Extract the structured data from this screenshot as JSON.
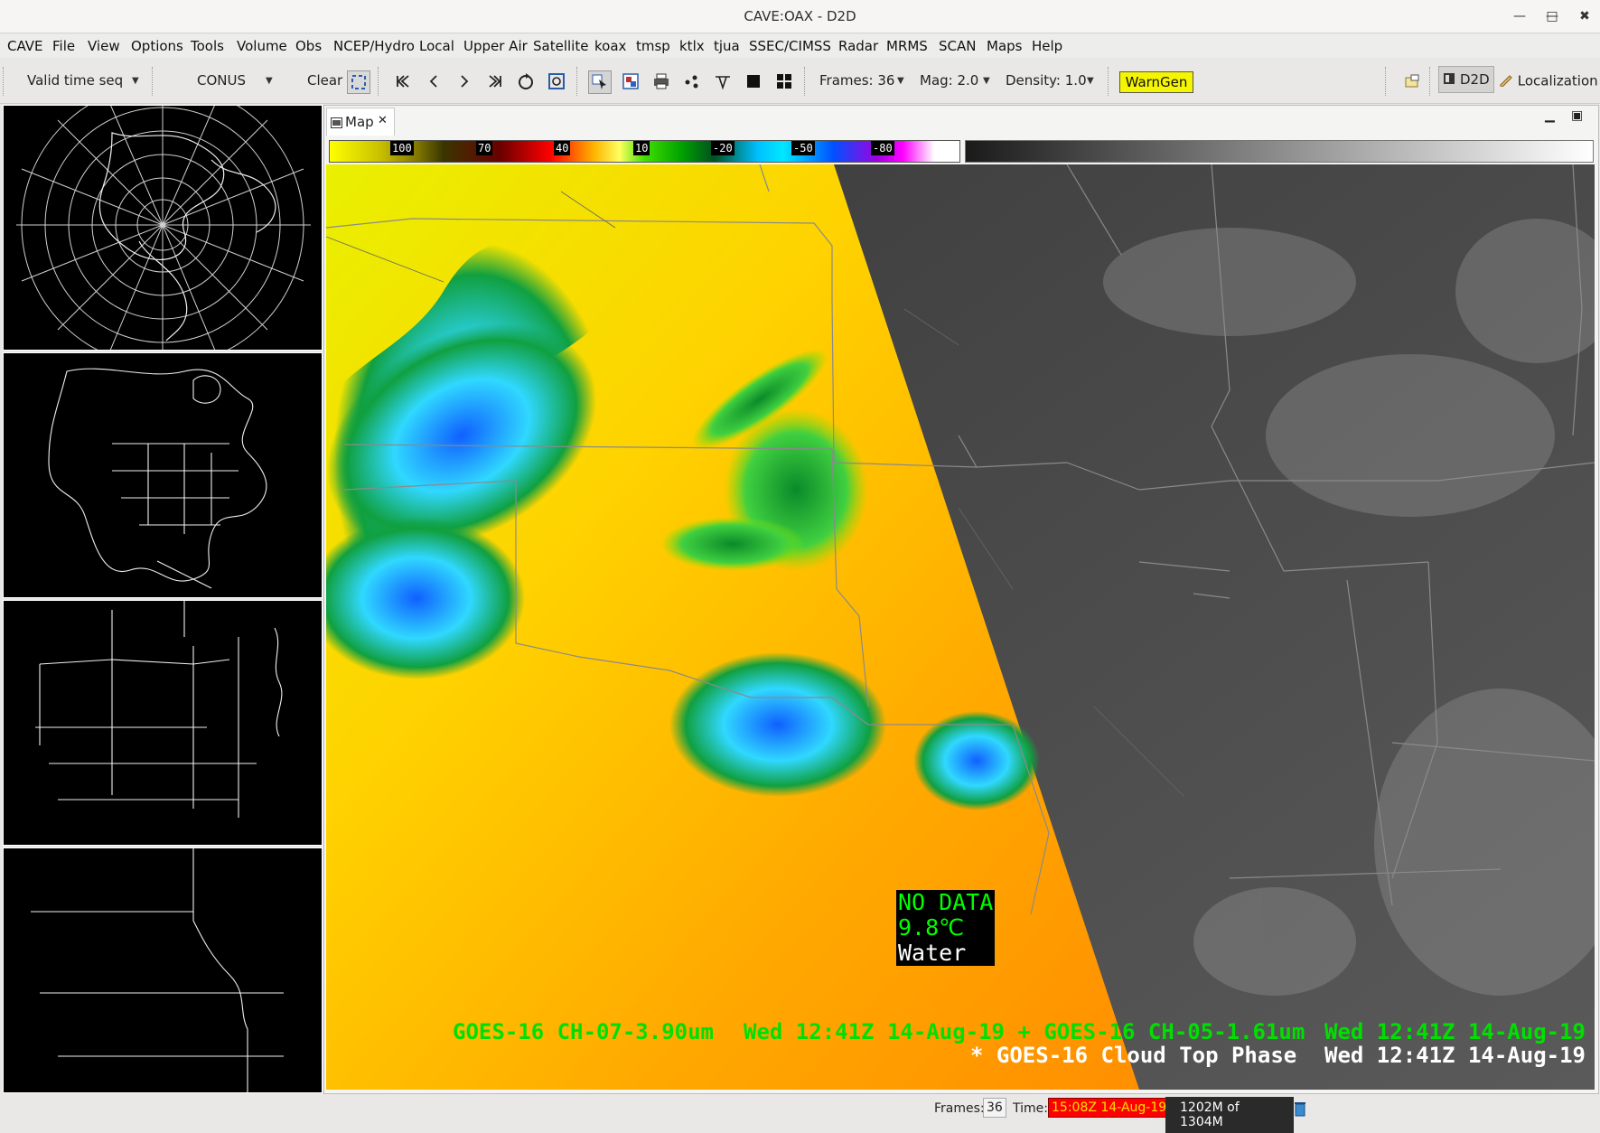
{
  "window": {
    "title": "CAVE:OAX - D2D",
    "minimize": "—",
    "maximize": "□",
    "close": "✖"
  },
  "menu": [
    "CAVE",
    "File",
    "View",
    "Options",
    "Tools",
    "Volume",
    "Obs",
    "NCEP/Hydro",
    "Local",
    "Upper Air",
    "Satellite",
    "koax",
    "tmsp",
    "ktlx",
    "tjua",
    "SSEC/CIMSS",
    "Radar",
    "MRMS",
    "SCAN",
    "Maps",
    "Help"
  ],
  "toolbar": {
    "time_mode": "Valid time seq",
    "scale": "CONUS",
    "clear": "Clear",
    "frames_label": "Frames: 36",
    "mag_label": "Mag: 2.0",
    "density_label": "Density: 1.0",
    "warngen": "WarnGen",
    "perspective": "D2D",
    "localization": "Localization"
  },
  "tab": {
    "label": "Map",
    "close": "✕"
  },
  "colorbar": {
    "ticks": [
      "100",
      "70",
      "40",
      "10",
      "-20",
      "-50",
      "-80"
    ]
  },
  "overlays": {
    "line1_left": "GOES-16 CH-07-3.90um",
    "line1_mid": "Wed 12:41Z 14-Aug-19 + GOES-16 CH-05-1.61um",
    "line1_right": "Wed 12:41Z 14-Aug-19",
    "line2_left": "* GOES-16 Cloud Top Phase",
    "line2_right": "Wed 12:41Z 14-Aug-19"
  },
  "probe": {
    "line1": "NO DATA",
    "line2": "9.8℃",
    "line3": "Water"
  },
  "status": {
    "frames_label": "Frames:",
    "frames_value": "36",
    "time_label": "Time:",
    "time_value": "15:08Z 14-Aug-19",
    "memory": "1202M of 1304M"
  },
  "colors": {
    "probe_green": "#00ff00",
    "overlay_green": "#00ff00",
    "time_bg": "#ff0000",
    "warngen_bg": "#f5f500"
  }
}
